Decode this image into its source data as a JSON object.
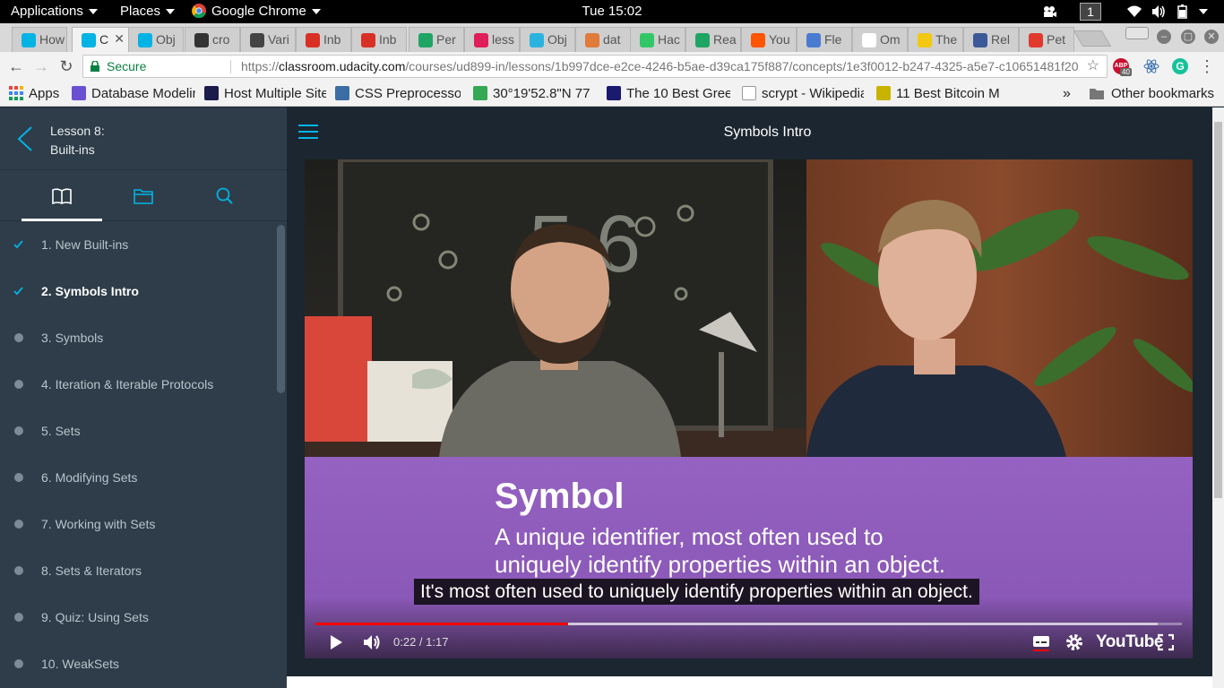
{
  "topbar": {
    "applications": "Applications",
    "places": "Places",
    "browser": "Google Chrome",
    "clock": "Tue 15:02",
    "workspace": "1"
  },
  "tabs": [
    {
      "title": "How",
      "color": "#02b3e4"
    },
    {
      "title": "C",
      "color": "#02b3e4"
    },
    {
      "title": "Obj",
      "color": "#02b3e4"
    },
    {
      "title": "cro",
      "color": "#333333"
    },
    {
      "title": "Vari",
      "color": "#444444"
    },
    {
      "title": "Inb",
      "color": "#d93025"
    },
    {
      "title": "Inb",
      "color": "#d93025"
    },
    {
      "title": "Per",
      "color": "#1fa463"
    },
    {
      "title": "less",
      "color": "#e01e5a"
    },
    {
      "title": "Obj",
      "color": "#2bb3e0"
    },
    {
      "title": "dat",
      "color": "#e07b39"
    },
    {
      "title": "Hac",
      "color": "#32c766"
    },
    {
      "title": "Rea",
      "color": "#1fa463"
    },
    {
      "title": "You",
      "color": "#ff5500"
    },
    {
      "title": "Fle",
      "color": "#4a7bd0"
    },
    {
      "title": "Om",
      "color": "#ffffff"
    },
    {
      "title": "The",
      "color": "#f2c811"
    },
    {
      "title": "Rel",
      "color": "#3b5998"
    },
    {
      "title": "Pet",
      "color": "#e03a2f"
    }
  ],
  "omnibox": {
    "secure_label": "Secure",
    "url_scheme": "https://",
    "url_host": "classroom.udacity.com",
    "url_path": "/courses/ud899-in/lessons/1b997dce-e2ce-4246-b5ae-d39ca175f887/concepts/1e3f0012-b247-4325-a5e7-c10651481f20",
    "abp_badge": "40"
  },
  "bookmarks": {
    "apps": "Apps",
    "items": [
      {
        "label": "Database Modelin",
        "color": "#6b4fd1"
      },
      {
        "label": "Host Multiple Site",
        "color": "#1c1c4a"
      },
      {
        "label": "CSS Preprocesso",
        "color": "#3b6ea5"
      },
      {
        "label": "30°19'52.8\"N 77",
        "color": "#34a853"
      },
      {
        "label": "The 10 Best Gree",
        "color": "#1a1a6e"
      },
      {
        "label": "scrypt - Wikipedia",
        "color": "#ffffff"
      },
      {
        "label": "11 Best Bitcoin M",
        "color": "#c8b400"
      }
    ],
    "overflow": "»",
    "other": "Other bookmarks"
  },
  "sidebar": {
    "lesson_number": "Lesson 8:",
    "lesson_title": "Built-ins",
    "concepts": [
      {
        "label": "1. New Built-ins",
        "status": "done"
      },
      {
        "label": "2. Symbols Intro",
        "status": "current"
      },
      {
        "label": "3. Symbols",
        "status": "todo"
      },
      {
        "label": "4. Iteration & Iterable Protocols",
        "status": "todo"
      },
      {
        "label": "5. Sets",
        "status": "todo"
      },
      {
        "label": "6. Modifying Sets",
        "status": "todo"
      },
      {
        "label": "7. Working with Sets",
        "status": "todo"
      },
      {
        "label": "8. Sets & Iterators",
        "status": "todo"
      },
      {
        "label": "9. Quiz: Using Sets",
        "status": "todo"
      },
      {
        "label": "10. WeakSets",
        "status": "todo"
      }
    ]
  },
  "main": {
    "title": "Symbols Intro"
  },
  "video": {
    "slide_title": "Symbol",
    "slide_line1": "A unique identifier, most often used to",
    "slide_line2": "uniquely identify properties within an object.",
    "caption": "It's most often used to uniquely identify properties within an object.",
    "current_time": "0:22",
    "duration": "1:17",
    "time_display": "0:22 / 1:17",
    "played_fraction": 0.2915,
    "buffered_fraction": 0.972,
    "brand": "YouTube"
  },
  "colors": {
    "accent": "#02b3e4",
    "sidebar_bg": "#2e3d49",
    "main_bg": "#1b2630",
    "slide_purple": "#9562c2",
    "progress_red": "#ff0000"
  }
}
